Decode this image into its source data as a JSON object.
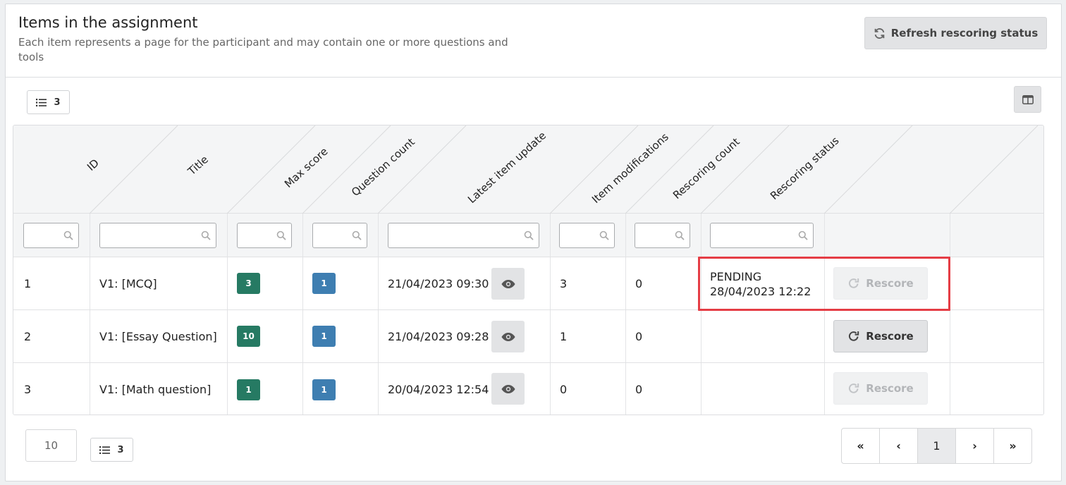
{
  "header": {
    "title": "Items in the assignment",
    "subtitle": "Each item represents a page for the participant and may contain one or more questions and tools",
    "refresh_label": "Refresh rescoring status"
  },
  "toolbar": {
    "row_count": "3"
  },
  "columns": [
    "ID",
    "Title",
    "Max score",
    "Question count",
    "Latest item update",
    "Item modifications",
    "Rescoring count",
    "Rescoring status"
  ],
  "rows": [
    {
      "id": "1",
      "title": "V1: [MCQ]",
      "max_score": "3",
      "question_count": "1",
      "latest_update": "21/04/2023 09:30",
      "modifications": "3",
      "rescoring_count": "0",
      "status": "PENDING",
      "status_time": "28/04/2023 12:22",
      "rescore_label": "Rescore",
      "rescore_enabled": false
    },
    {
      "id": "2",
      "title": "V1: [Essay Question]",
      "max_score": "10",
      "question_count": "1",
      "latest_update": "21/04/2023 09:28",
      "modifications": "1",
      "rescoring_count": "0",
      "status": "",
      "status_time": "",
      "rescore_label": "Rescore",
      "rescore_enabled": true
    },
    {
      "id": "3",
      "title": "V1: [Math question]",
      "max_score": "1",
      "question_count": "1",
      "latest_update": "20/04/2023 12:54",
      "modifications": "0",
      "rescoring_count": "0",
      "status": "",
      "status_time": "",
      "rescore_label": "Rescore",
      "rescore_enabled": false
    }
  ],
  "footer": {
    "page_size": "10",
    "row_count": "3",
    "pager": {
      "first": "«",
      "prev": "‹",
      "current": "1",
      "next": "›",
      "last": "»"
    }
  },
  "colors": {
    "badge_score": "#267a63",
    "badge_count": "#3e7eb1",
    "highlight": "#e53d45"
  },
  "icons": [
    "refresh-icon",
    "list-icon",
    "columns-icon",
    "search-icon",
    "eye-icon",
    "redo-icon"
  ]
}
